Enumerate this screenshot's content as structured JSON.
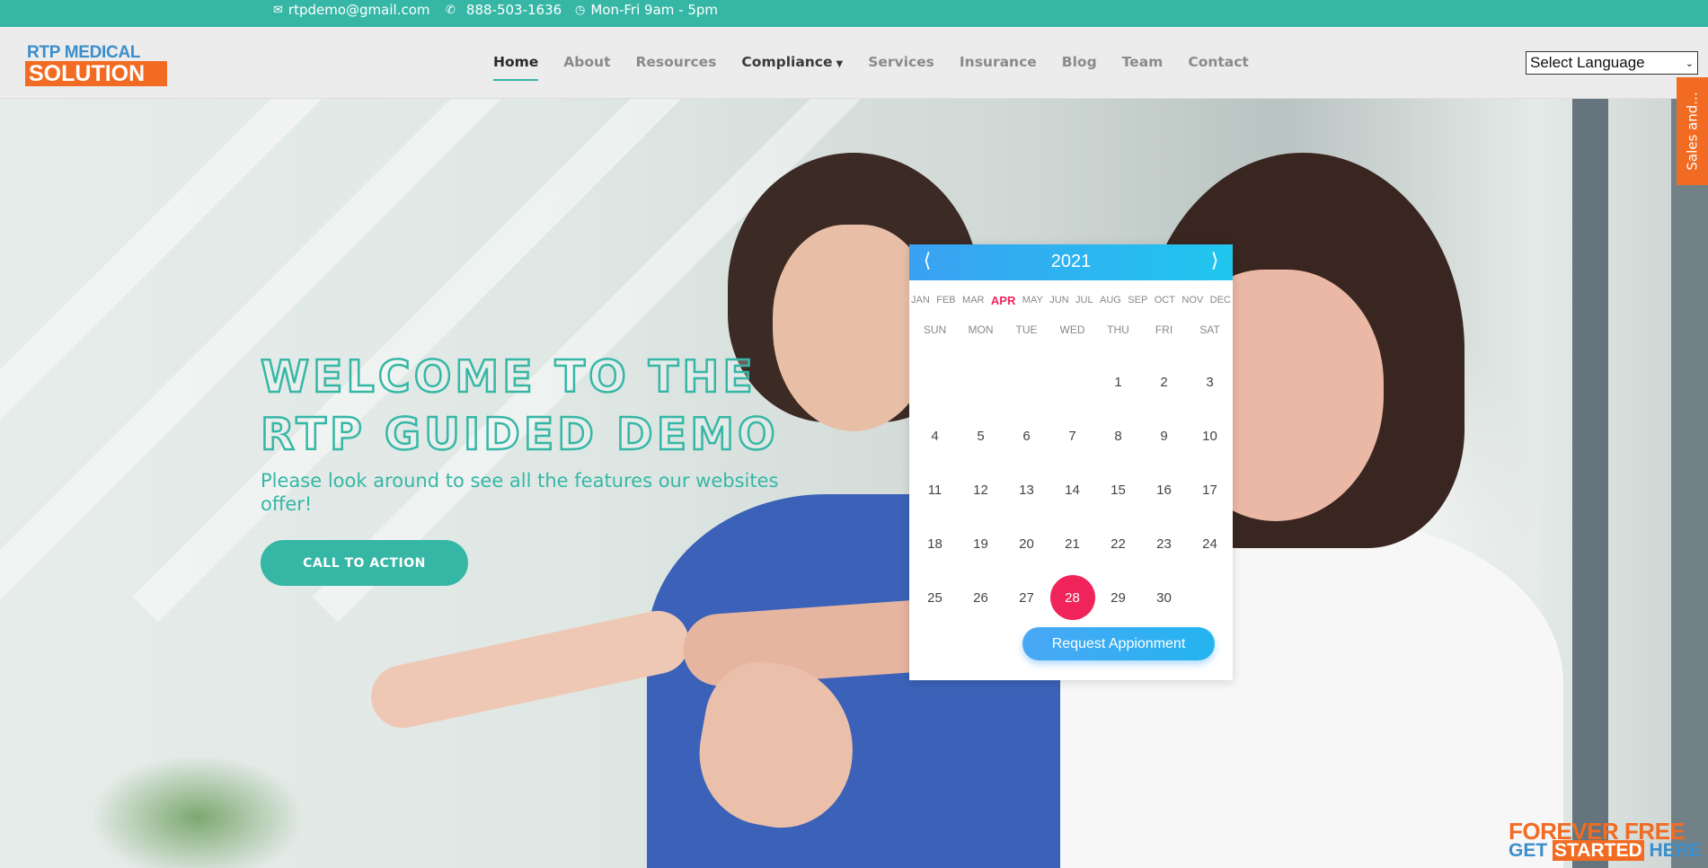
{
  "topbar": {
    "email": "rtpdemo@gmail.com",
    "phone": "888-503-1636",
    "hours": "Mon-Fri 9am - 5pm"
  },
  "logo": {
    "line1": "RTP MEDICAL",
    "line2": "SOLUTION"
  },
  "nav": {
    "home": "Home",
    "about": "About",
    "resources": "Resources",
    "compliance": "Compliance",
    "services": "Services",
    "insurance": "Insurance",
    "blog": "Blog",
    "team": "Team",
    "contact": "Contact"
  },
  "language": {
    "selected": "Select Language"
  },
  "hero": {
    "headline_line1": "WELCOME TO THE",
    "headline_line2": "RTP GUIDED DEMO",
    "subtitle": "Please look around to see all the features our websites offer!",
    "cta": "CALL TO ACTION"
  },
  "calendar": {
    "year": "2021",
    "prev": "⟨",
    "next": "⟩",
    "months": [
      "JAN",
      "FEB",
      "MAR",
      "APR",
      "MAY",
      "JUN",
      "JUL",
      "AUG",
      "SEP",
      "OCT",
      "NOV",
      "DEC"
    ],
    "selected_month": "APR",
    "weekdays": [
      "SUN",
      "MON",
      "TUE",
      "WED",
      "THU",
      "FRI",
      "SAT"
    ],
    "days": [
      "",
      "",
      "",
      "",
      "1",
      "2",
      "3",
      "4",
      "5",
      "6",
      "7",
      "8",
      "9",
      "10",
      "11",
      "12",
      "13",
      "14",
      "15",
      "16",
      "17",
      "18",
      "19",
      "20",
      "21",
      "22",
      "23",
      "24",
      "25",
      "26",
      "27",
      "28",
      "29",
      "30",
      ""
    ],
    "selected_day": "28",
    "request_button": "Request Appionment"
  },
  "side_tab": "Sales and...",
  "badge": {
    "line1": "FOREVER FREE",
    "line2_a": "GET ",
    "line2_b": "STARTED",
    "line2_c": " HERE"
  },
  "colors": {
    "teal": "#36b7a6",
    "orange": "#f26b22",
    "pink": "#f0245a",
    "blue": "#3aa1f2"
  }
}
